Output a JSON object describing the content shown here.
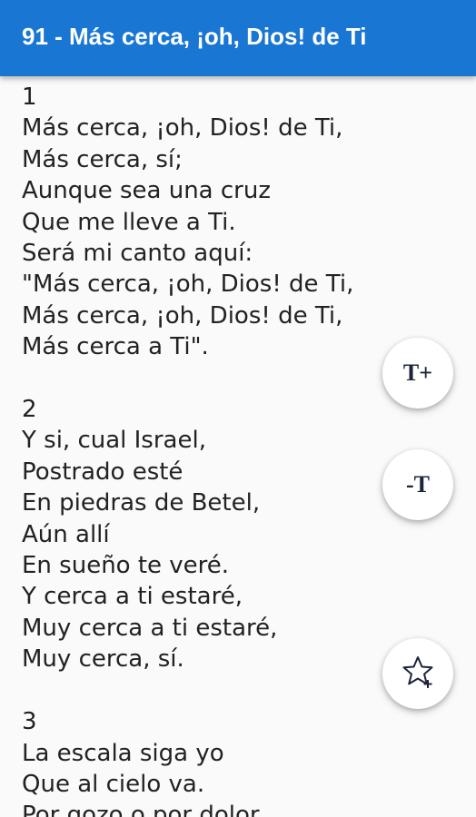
{
  "header": {
    "title": "91 - Más cerca, ¡oh, Dios! de Ti",
    "background_color": "#1976d2"
  },
  "lyrics": [
    "1",
    "Más cerca, ¡oh, Dios! de Ti,",
    "Más cerca, sí;",
    "Aunque sea una cruz",
    "Que me lleve a Ti.",
    "Será mi canto aquí:",
    "\"Más cerca, ¡oh, Dios! de Ti,",
    "Más cerca, ¡oh, Dios! de Ti,",
    "Más cerca a Ti\".",
    "",
    "2",
    "Y si, cual Israel,",
    "Postrado esté",
    "En piedras de Betel,",
    "Aún allí",
    "En sueño te veré.",
    "Y cerca a ti estaré,",
    "Muy cerca a ti estaré,",
    "Muy cerca, sí.",
    "",
    "3",
    "La escala siga yo",
    "Que al cielo va.",
    "Por gozo o por dolor"
  ],
  "buttons": {
    "increase_font_label": "T+",
    "decrease_font_label": "-T",
    "favorite_icon": "star-plus-icon"
  }
}
